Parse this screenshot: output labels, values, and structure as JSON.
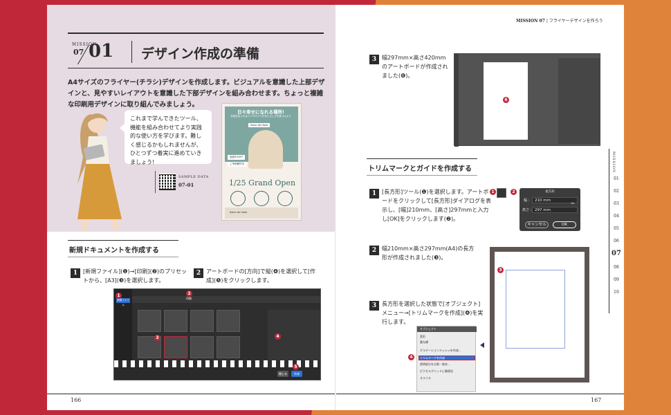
{
  "left_page": {
    "mission_label": "MISSION",
    "mission_chapter": "07",
    "mission_number": "01",
    "mission_title": "デザイン作成の準備",
    "intro": "A4サイズのフライヤー(チラシ)デザインを作成します。ビジュアルを意識した上部デザインと、見やすいレイアウトを意識した下部デザインを組み合わせます。ちょっと複雑な印刷用デザインに取り組んでみましょう。",
    "bubble": "これまで学んできたツール、機能を組み合わせてより実践的な使い方を学びます。難しく感じるかもしれませんが、ひとつずつ着実に進めていきましょう!",
    "sample_label": "SAMPLE DATA",
    "sample_number": "07-01",
    "flyer": {
      "headline": "日々幸せになれる場所!",
      "subline": "自然光あふれるヘアサロンでおなたらしさを見つけよう",
      "tag1": "Salon de Hoka",
      "tag2": "全品5%OFF",
      "tag3": "ご予約受付中",
      "open": "1/25 Grand Open",
      "shop": "Salon de Hoka"
    },
    "section_title": "新規ドキュメントを作成する",
    "step1": {
      "num": "1",
      "text": "[新規ファイル](❶)→[印刷](❷)のプリセットから、[A3](❸)を選択します。"
    },
    "step2": {
      "num": "2",
      "text": "アートボードの[方向]で縦(❹)を選択して[作成](❺)をクリックします。"
    },
    "ui": {
      "new_file": "新規ファイル",
      "print": "印刷",
      "cancel": "閉じる",
      "create": "作成"
    },
    "badges": [
      "1",
      "2",
      "3",
      "4",
      "5"
    ],
    "page_number": "166"
  },
  "right_page": {
    "header_mission": "MISSION 07",
    "header_text": "フライヤーデザインを作ろう",
    "step3": {
      "num": "3",
      "text": "幅297mm×高さ420mmのアートボードが作成されました(❻)。"
    },
    "badge6": "6",
    "section_title": "トリムマークとガイドを作成する",
    "trim_step1": {
      "num": "1",
      "text": "[長方形]ツール(❶)を選択します。アートボードをクリックして[長方形]ダイアログを表示し、[幅]210mm、[高さ]297mmと入力し[OK]をクリックします(❷)。"
    },
    "dialog": {
      "title": "長方形",
      "width_label": "幅 :",
      "width_value": "210 mm",
      "height_label": "高さ :",
      "height_value": "297 mm",
      "cancel": "キャンセル",
      "ok": "OK"
    },
    "trim_step2": {
      "num": "2",
      "text": "幅210mm×高さ297mm(A4)の長方形が作成されました(❸)。"
    },
    "trim_step3": {
      "num": "3",
      "text": "長方形を選択した状態で[オブジェクト]メニュー→[トリムマークを作成](❹)を実行します。"
    },
    "menu": {
      "title": "オブジェクト",
      "items": [
        "変形",
        "重ね順",
        "グラデーションメッシュを作成...",
        "トリムマークを作成",
        "透明部分を分割・統合...",
        "ピクセルグリッドに最適化",
        "スライス"
      ]
    },
    "badges": [
      "1",
      "2",
      "3",
      "4"
    ],
    "side_nav": {
      "title": "MISSION",
      "items": [
        "01",
        "02",
        "03",
        "04",
        "05",
        "06",
        "07",
        "08",
        "09",
        "10"
      ],
      "active": "07"
    },
    "page_number": "167"
  }
}
